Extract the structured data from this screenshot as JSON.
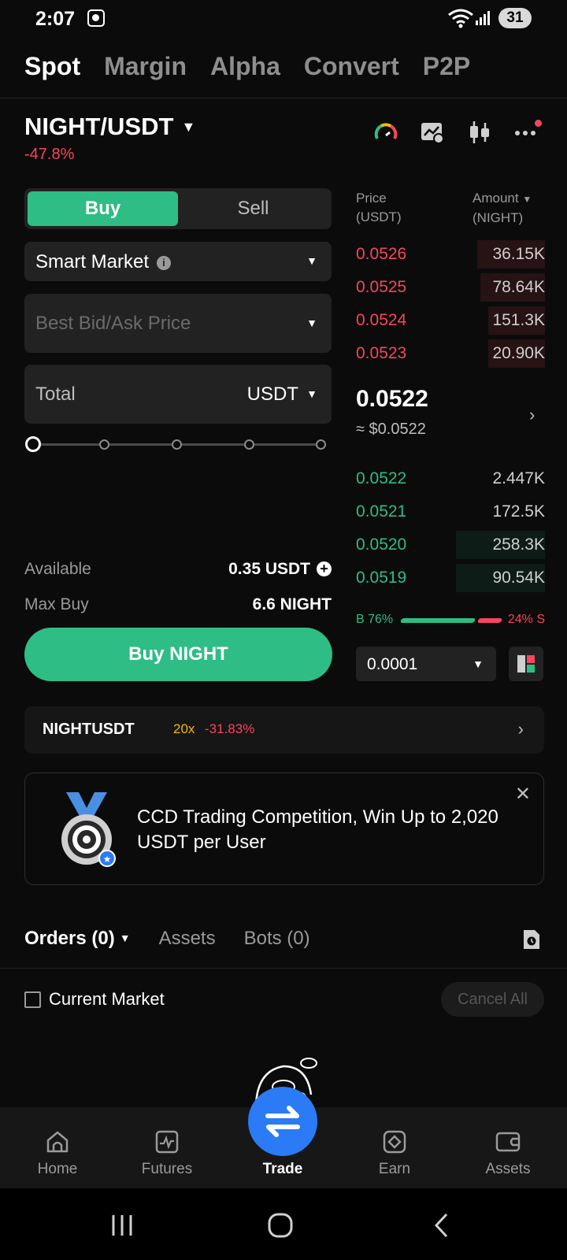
{
  "status_bar": {
    "time": "2:07",
    "battery": "31"
  },
  "top_tabs": [
    "Spot",
    "Margin",
    "Alpha",
    "Convert",
    "P2P"
  ],
  "pair": {
    "symbol": "NIGHT/USDT",
    "change": "-47.8%"
  },
  "trade": {
    "buy_label": "Buy",
    "sell_label": "Sell",
    "order_type": "Smart Market",
    "price_placeholder": "Best Bid/Ask Price",
    "total_label": "Total",
    "total_unit": "USDT",
    "slider_fraction": 0,
    "available_label": "Available",
    "available_value": "0.35 USDT",
    "max_buy_label": "Max Buy",
    "max_buy_value": "6.6 NIGHT",
    "submit_label": "Buy NIGHT"
  },
  "order_book": {
    "price_header": "Price",
    "price_unit": "(USDT)",
    "amount_header": "Amount",
    "amount_unit": "(NIGHT)",
    "asks": [
      {
        "price": "0.0526",
        "amount": "36.15K",
        "depth": 0.36
      },
      {
        "price": "0.0525",
        "amount": "78.64K",
        "depth": 0.34
      },
      {
        "price": "0.0524",
        "amount": "151.3K",
        "depth": 0.3
      },
      {
        "price": "0.0523",
        "amount": "20.90K",
        "depth": 0.3
      }
    ],
    "last_price": "0.0522",
    "last_price_usd": "≈ $0.0522",
    "bids": [
      {
        "price": "0.0522",
        "amount": "2.447K",
        "depth": 0.0
      },
      {
        "price": "0.0521",
        "amount": "172.5K",
        "depth": 0.0
      },
      {
        "price": "0.0520",
        "amount": "258.3K",
        "depth": 0.47
      },
      {
        "price": "0.0519",
        "amount": "90.54K",
        "depth": 0.47
      }
    ],
    "buy_ratio": "B 76%",
    "sell_ratio": "24% S",
    "buy_fraction": 0.76,
    "tick_size": "0.0001"
  },
  "futures_link": {
    "symbol": "NIGHTUSDT",
    "leverage": "20x",
    "change": "-31.83%"
  },
  "promo": {
    "text": "CCD Trading Competition, Win Up to 2,020 USDT per User"
  },
  "orders": {
    "tabs": [
      "Orders (0)",
      "Assets",
      "Bots (0)"
    ],
    "current_market_label": "Current Market",
    "cancel_all_label": "Cancel All"
  },
  "bottom_nav": [
    "Home",
    "Futures",
    "Trade",
    "Earn",
    "Assets"
  ],
  "colors": {
    "buy": "#2ebd85",
    "sell": "#f6465d",
    "fab": "#2a7bf5",
    "leverage": "#f0b90b"
  },
  "icons": {
    "status": [
      "screen-record-icon",
      "wifi-icon",
      "signal-icon"
    ],
    "header": [
      "gauge-icon",
      "chart-settings-icon",
      "candlestick-icon",
      "more-icon"
    ],
    "bottom_nav": [
      "home-icon",
      "futures-icon",
      "swap-icon",
      "earn-icon",
      "wallet-icon"
    ]
  }
}
